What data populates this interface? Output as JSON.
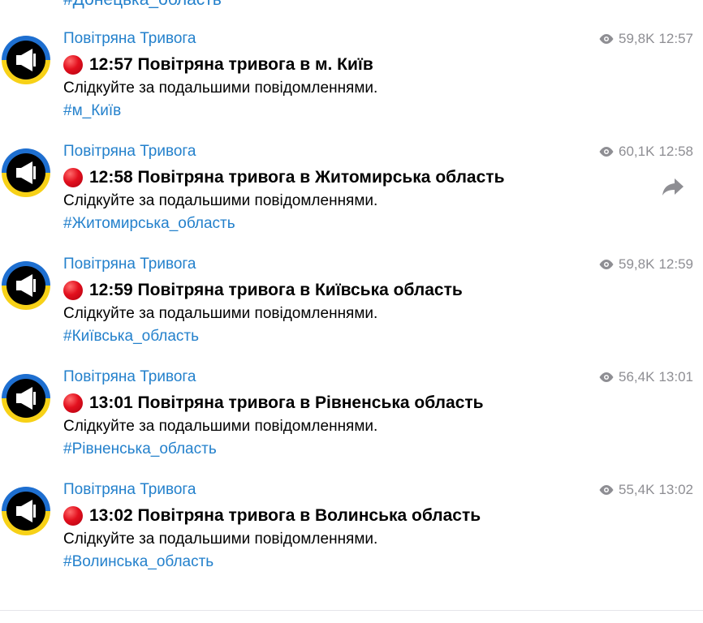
{
  "top_hashtag": "#Донецька_область",
  "posts": [
    {
      "channel": "Повітряна Тривога",
      "views": "59,8K",
      "time": "12:57",
      "title": "12:57 Повітряна тривога в м. Київ",
      "body": "Слідкуйте за подальшими повідомленнями.",
      "hashtag": "#м_Київ"
    },
    {
      "channel": "Повітряна Тривога",
      "views": "60,1K",
      "time": "12:58",
      "title": "12:58 Повітряна тривога в Житомирська область",
      "body": "Слідкуйте за подальшими повідомленнями.",
      "hashtag": "#Житомирська_область",
      "share_icon": "share-icon"
    },
    {
      "channel": "Повітряна Тривога",
      "views": "59,8K",
      "time": "12:59",
      "title": "12:59 Повітряна тривога в Київська область",
      "body": "Слідкуйте за подальшими повідомленнями.",
      "hashtag": "#Київська_область"
    },
    {
      "channel": "Повітряна Тривога",
      "views": "56,4K",
      "time": "13:01",
      "title": "13:01 Повітряна тривога в Рівненська область",
      "body": "Слідкуйте за подальшими повідомленнями.",
      "hashtag": "#Рівненська_область"
    },
    {
      "channel": "Повітряна Тривога",
      "views": "55,4K",
      "time": "13:02",
      "title": "13:02 Повітряна тривога в Волинська область",
      "body": "Слідкуйте за подальшими повідомленнями.",
      "hashtag": "#Волинська_область"
    }
  ],
  "colors": {
    "link": "#2481cc",
    "meta": "#8e8e93",
    "alert_dot": "#e3101e",
    "avatar_blue": "#1e6fd0",
    "avatar_yellow": "#f7d117"
  },
  "icons": {
    "avatar": "megaphone-icon",
    "views": "eye-icon",
    "alert": "red-circle-icon",
    "share": "share-icon"
  }
}
